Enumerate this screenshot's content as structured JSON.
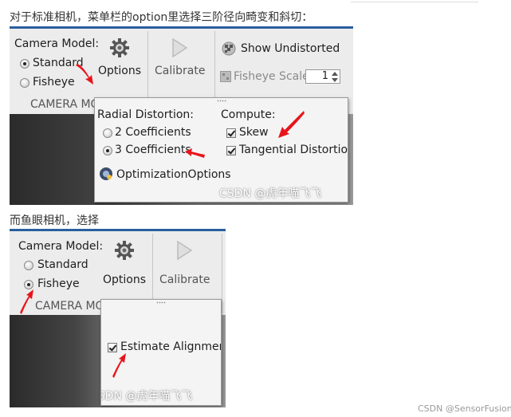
{
  "caption_1": "对于标准相机，菜单栏的option里选择三阶径向畸变和斜切：",
  "caption_2": "而鱼眼相机，选择",
  "screenshot_1": {
    "camera_model_label": "Camera Model:",
    "standard_label": "Standard",
    "fisheye_label": "Fisheye",
    "options_label": "Options",
    "calibrate_label": "Calibrate",
    "show_undistorted_label": "Show Undistorted",
    "fisheye_scale_label": "Fisheye Scale",
    "fisheye_scale_value": "1",
    "section_label": "CAMERA MO",
    "popup": {
      "radial_distortion_label": "Radial Distortion:",
      "two_coefficients_label": "2 Coefficients",
      "three_coefficients_label": "3 Coefficients",
      "optimization_options_label": "OptimizationOptions",
      "compute_label": "Compute:",
      "skew_label": "Skew",
      "tangential_label": "Tangential Distortion"
    },
    "watermark": "CSDN @虎年喵飞飞"
  },
  "screenshot_2": {
    "camera_model_label": "Camera Model:",
    "standard_label": "Standard",
    "fisheye_label": "Fisheye",
    "options_label": "Options",
    "calibrate_label": "Calibrate",
    "section_label": "CAMERA MO",
    "popup": {
      "estimate_alignment_label": "Estimate Alignment"
    },
    "watermark": "CSDN @虎年喵飞飞"
  },
  "footer_watermark": "CSDN @SensorFusion",
  "colors": {
    "accent_blue": "#2a5f9e",
    "toolbar_gray": "#ececec",
    "arrow_red": "#e8141b"
  }
}
